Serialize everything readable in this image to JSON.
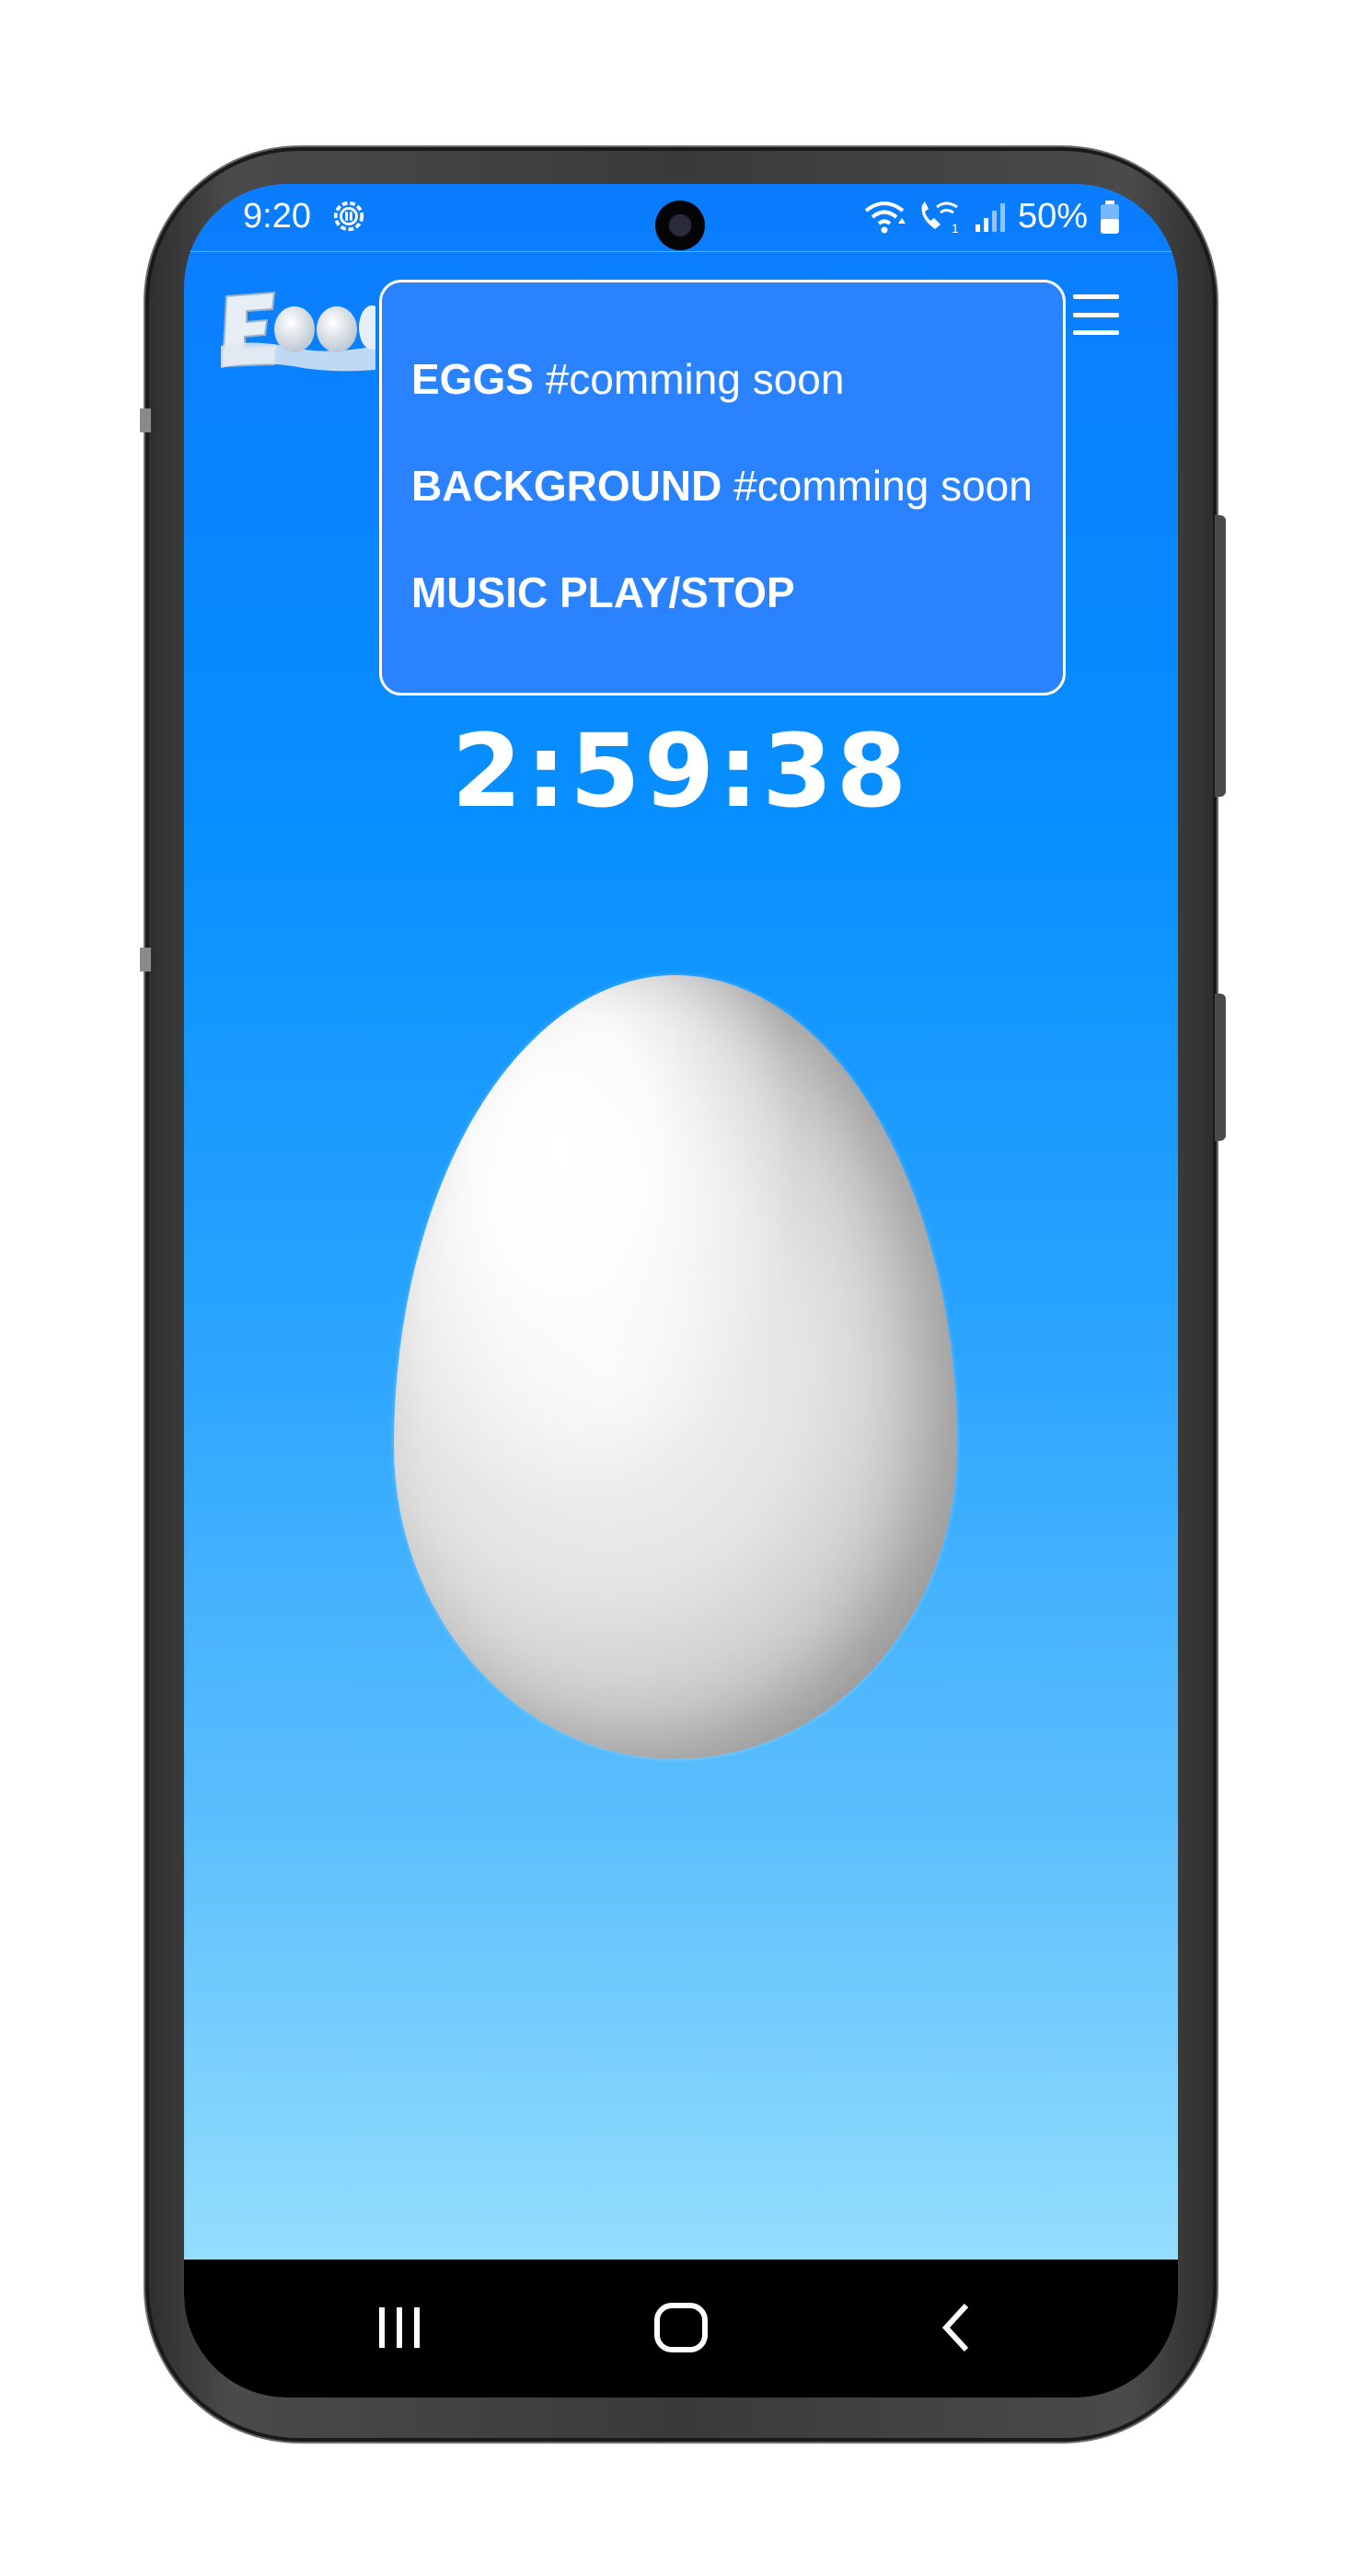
{
  "status_bar": {
    "time": "9:20",
    "battery": "50%",
    "icons": [
      "settings-status-icon",
      "wifi-icon",
      "wifi-calling-icon",
      "signal-icon",
      "battery-icon"
    ]
  },
  "app": {
    "logo_icon": "egg-logo-icon",
    "menu_icon": "hamburger-menu-icon",
    "menu": {
      "items": [
        {
          "label": "EGGS",
          "note": "#comming soon"
        },
        {
          "label": "BACKGROUND",
          "note": "#comming soon"
        },
        {
          "label": "MUSIC PLAY/STOP",
          "note": ""
        }
      ]
    },
    "timer": "2:59:38",
    "egg_icon": "egg-image"
  },
  "colors": {
    "background_top": "#0a7cff",
    "background_bottom": "#a6e8ff",
    "menu_panel": "#2a82ff",
    "text": "#ffffff"
  },
  "nav_bar": {
    "buttons": [
      "recent-apps-icon",
      "home-icon",
      "back-icon"
    ]
  }
}
